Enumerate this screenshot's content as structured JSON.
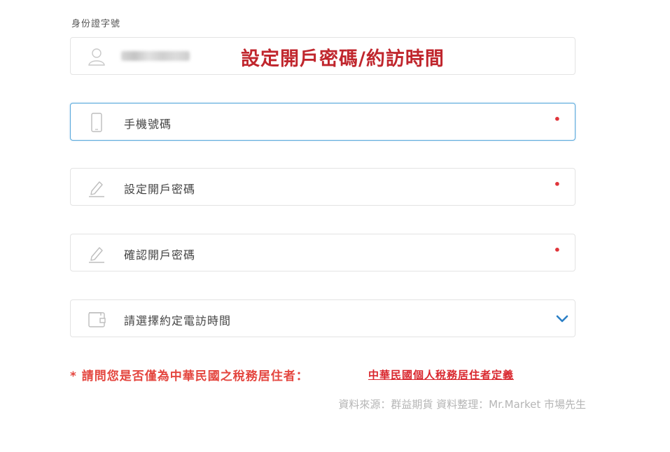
{
  "form": {
    "id_label": "身份證字號",
    "overlay_title": "設定開戶密碼/約訪時間",
    "fields": [
      {
        "placeholder": "手機號碼",
        "required_mark": "•"
      },
      {
        "placeholder": "設定開戶密碼",
        "required_mark": "•"
      },
      {
        "placeholder": "確認開戶密碼",
        "required_mark": "•"
      },
      {
        "placeholder": "請選擇約定電訪時間"
      }
    ],
    "tax_question": "* 請問您是否僅為中華民國之稅務居住者：",
    "tax_definition_link": "中華民國個人稅務居住者定義"
  },
  "source_note": "資料來源：群益期貨  資料整理：Mr.Market 市場先生",
  "colors": {
    "accent_red": "#e4463f",
    "focus_blue": "#5aa9dc",
    "chevron_blue": "#2b7fc6"
  },
  "icons": {
    "id": "user-icon",
    "phone": "mobile-phone-icon",
    "password": "pencil-icon",
    "confirm_password": "pencil-icon",
    "time": "wallet-icon",
    "dropdown": "chevron-down-icon"
  }
}
